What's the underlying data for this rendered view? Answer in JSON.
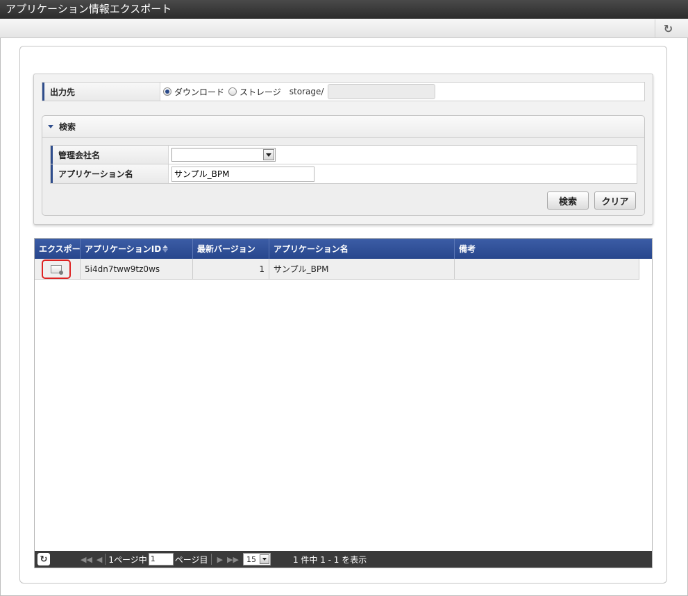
{
  "window": {
    "title": "アプリケーション情報エクスポート"
  },
  "output": {
    "label": "出力先",
    "option_download": "ダウンロード",
    "option_storage": "ストレージ",
    "selected": "ダウンロード",
    "storage_prefix": "storage/",
    "storage_path": ""
  },
  "search": {
    "header": "検索",
    "company_label": "管理会社名",
    "company_value": "",
    "app_name_label": "アプリケーション名",
    "app_name_value": "サンプル_BPM",
    "search_button": "検索",
    "clear_button": "クリア"
  },
  "grid": {
    "columns": [
      "エクスポート",
      "アプリケーションID",
      "最新バージョン",
      "アプリケーション名",
      "備考"
    ],
    "rows": [
      {
        "app_id": "5i4dn7tww9tz0ws",
        "version": "1",
        "app_name": "サンプル_BPM",
        "note": ""
      }
    ]
  },
  "pager": {
    "page_prefix": "1ページ中",
    "current_page": "1",
    "page_suffix": "ページ目",
    "page_size": "15",
    "summary": "1 件中 1 - 1 を表示"
  }
}
